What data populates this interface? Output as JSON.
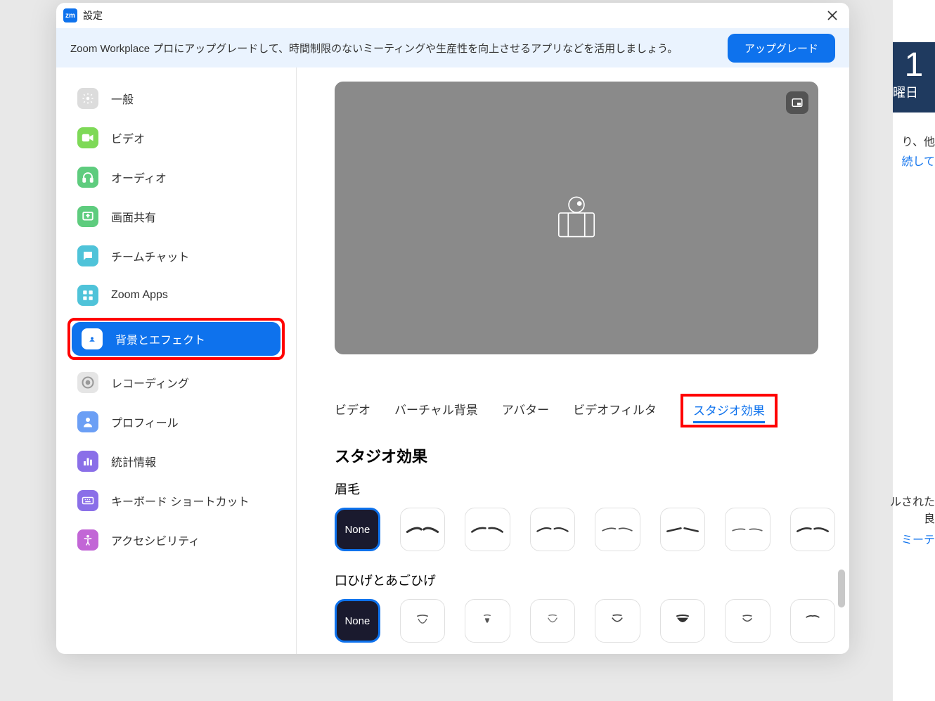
{
  "window": {
    "title": "設定"
  },
  "banner": {
    "text": "Zoom Workplace プロにアップグレードして、時間制限のないミーティングや生産性を向上させるアプリなどを活用しましょう。",
    "button": "アップグレード"
  },
  "sidebar": {
    "items": [
      {
        "label": "一般"
      },
      {
        "label": "ビデオ"
      },
      {
        "label": "オーディオ"
      },
      {
        "label": "画面共有"
      },
      {
        "label": "チームチャット"
      },
      {
        "label": "Zoom Apps"
      },
      {
        "label": "背景とエフェクト"
      },
      {
        "label": "レコーディング"
      },
      {
        "label": "プロフィール"
      },
      {
        "label": "統計情報"
      },
      {
        "label": "キーボード ショートカット"
      },
      {
        "label": "アクセシビリティ"
      }
    ]
  },
  "tabs": {
    "items": [
      {
        "label": "ビデオ"
      },
      {
        "label": "バーチャル背景"
      },
      {
        "label": "アバター"
      },
      {
        "label": "ビデオフィルタ"
      },
      {
        "label": "スタジオ効果"
      }
    ]
  },
  "studio": {
    "title": "スタジオ効果",
    "eyebrows_label": "眉毛",
    "beard_label": "口ひげとあごひげ",
    "none": "None"
  },
  "background": {
    "big_number": "1",
    "day": "曜日",
    "t1": "り、他",
    "t2": "続して",
    "t3a": "ルされた",
    "t3b": "良",
    "t4": "ミーテ"
  }
}
